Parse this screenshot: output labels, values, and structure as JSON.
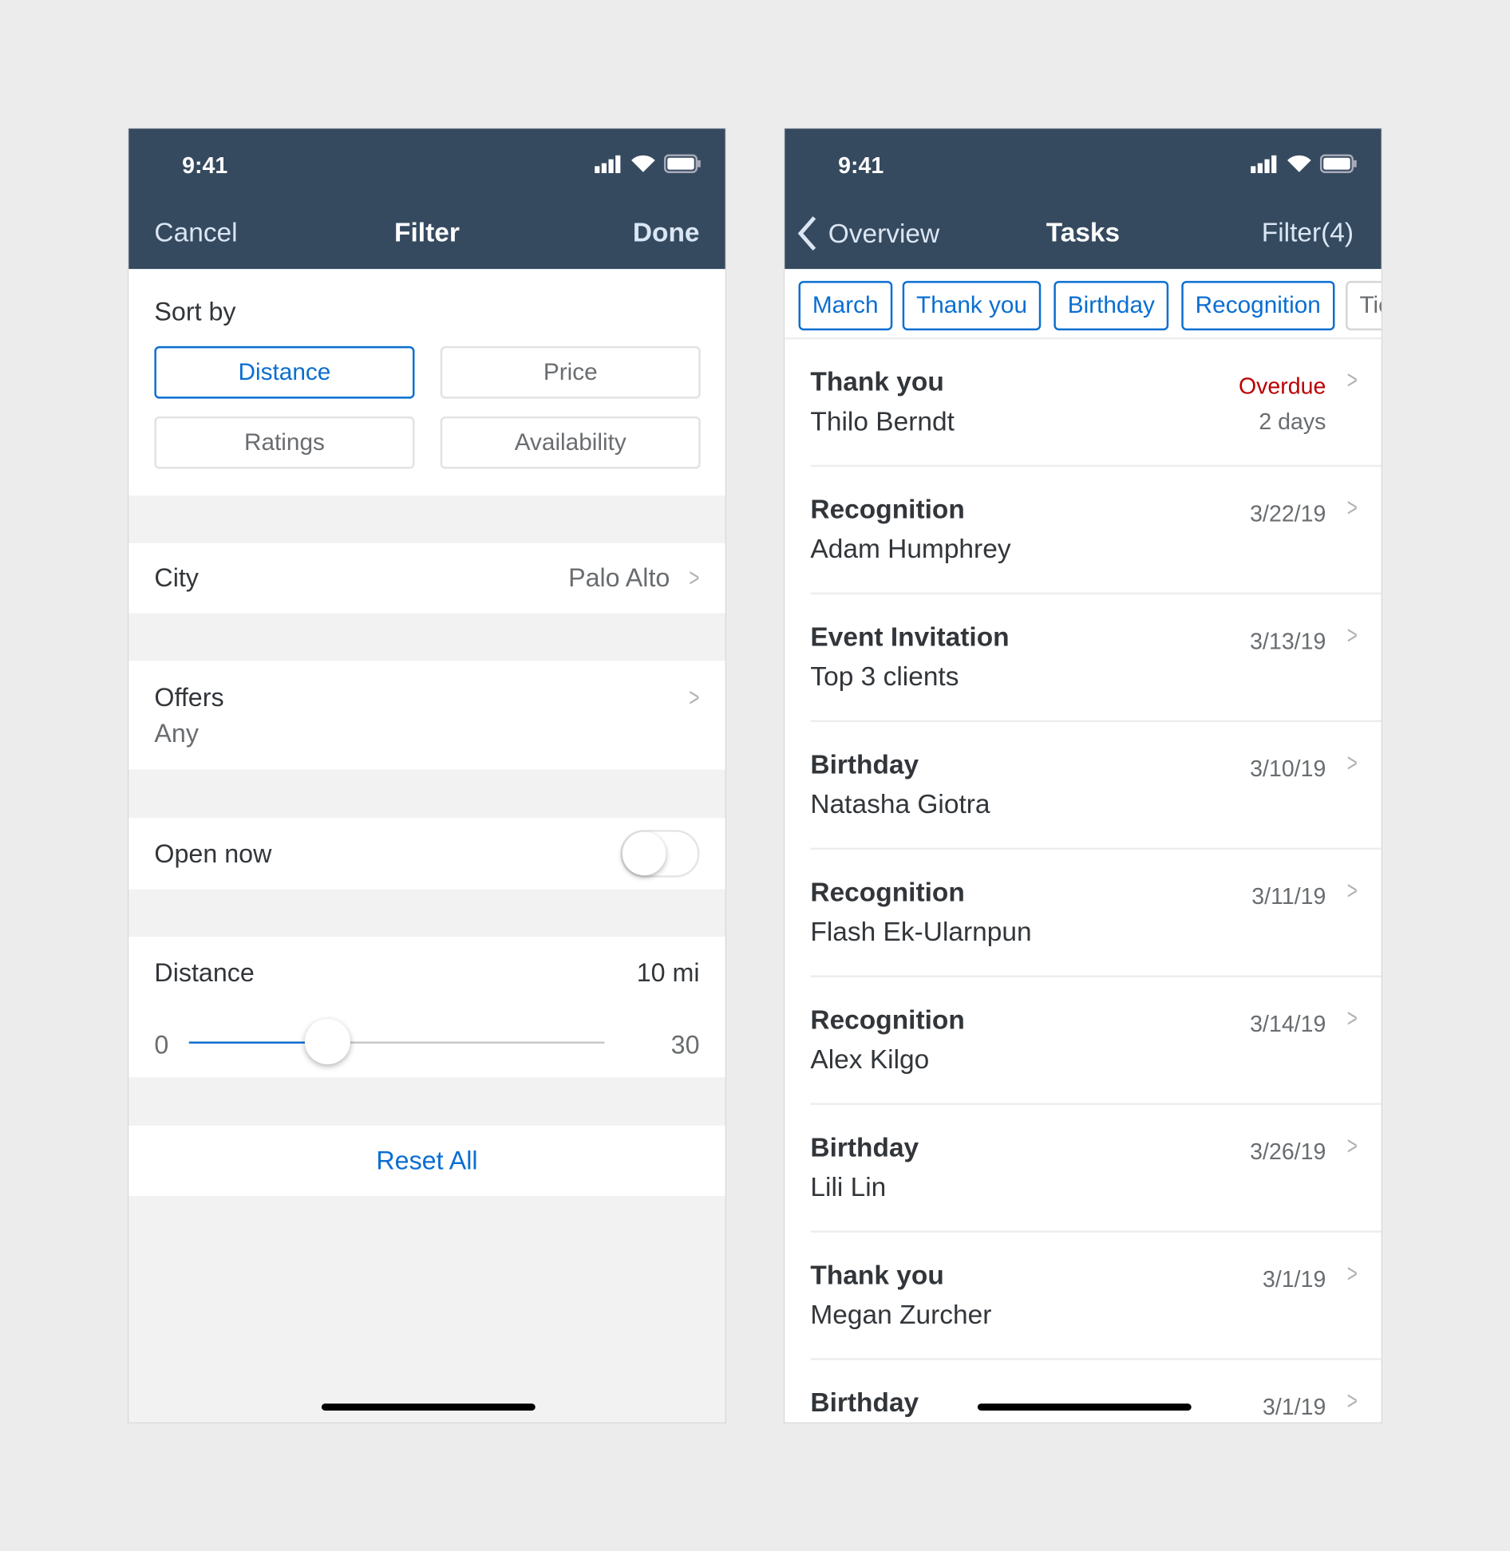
{
  "status_bar": {
    "time": "9:41"
  },
  "filter_screen": {
    "nav": {
      "cancel": "Cancel",
      "title": "Filter",
      "done": "Done"
    },
    "sort_by": {
      "label": "Sort by",
      "options": [
        {
          "label": "Distance",
          "selected": true
        },
        {
          "label": "Price",
          "selected": false
        },
        {
          "label": "Ratings",
          "selected": false
        },
        {
          "label": "Availability",
          "selected": false
        }
      ]
    },
    "city": {
      "label": "City",
      "value": "Palo Alto"
    },
    "offers": {
      "label": "Offers",
      "value": "Any"
    },
    "open_now": {
      "label": "Open now",
      "on": false
    },
    "distance": {
      "label": "Distance",
      "value": "10 mi",
      "min": "0",
      "max": "30",
      "current": 10
    },
    "reset": "Reset All"
  },
  "tasks_screen": {
    "nav": {
      "back": "Overview",
      "title": "Tasks",
      "filter": "Filter(4)"
    },
    "chips": [
      "March",
      "Thank you",
      "Birthday",
      "Recognition",
      "Tie"
    ],
    "items": [
      {
        "title": "Thank you",
        "subtitle": "Thilo Berndt",
        "status": "Overdue",
        "detail": "2 days"
      },
      {
        "title": "Recognition",
        "subtitle": "Adam Humphrey",
        "date": "3/22/19"
      },
      {
        "title": "Event Invitation",
        "subtitle": "Top 3 clients",
        "date": "3/13/19"
      },
      {
        "title": "Birthday",
        "subtitle": "Natasha Giotra",
        "date": "3/10/19"
      },
      {
        "title": "Recognition",
        "subtitle": "Flash Ek-Ularnpun",
        "date": "3/11/19"
      },
      {
        "title": "Recognition",
        "subtitle": "Alex Kilgo",
        "date": "3/14/19"
      },
      {
        "title": "Birthday",
        "subtitle": "Lili Lin",
        "date": "3/26/19"
      },
      {
        "title": "Thank you",
        "subtitle": "Megan Zurcher",
        "date": "3/1/19"
      },
      {
        "title": "Birthday",
        "subtitle": "",
        "date": "3/1/19"
      }
    ]
  },
  "colors": {
    "header": "#354a5f",
    "accent": "#0a6ed1",
    "overdue": "#bb0000"
  }
}
